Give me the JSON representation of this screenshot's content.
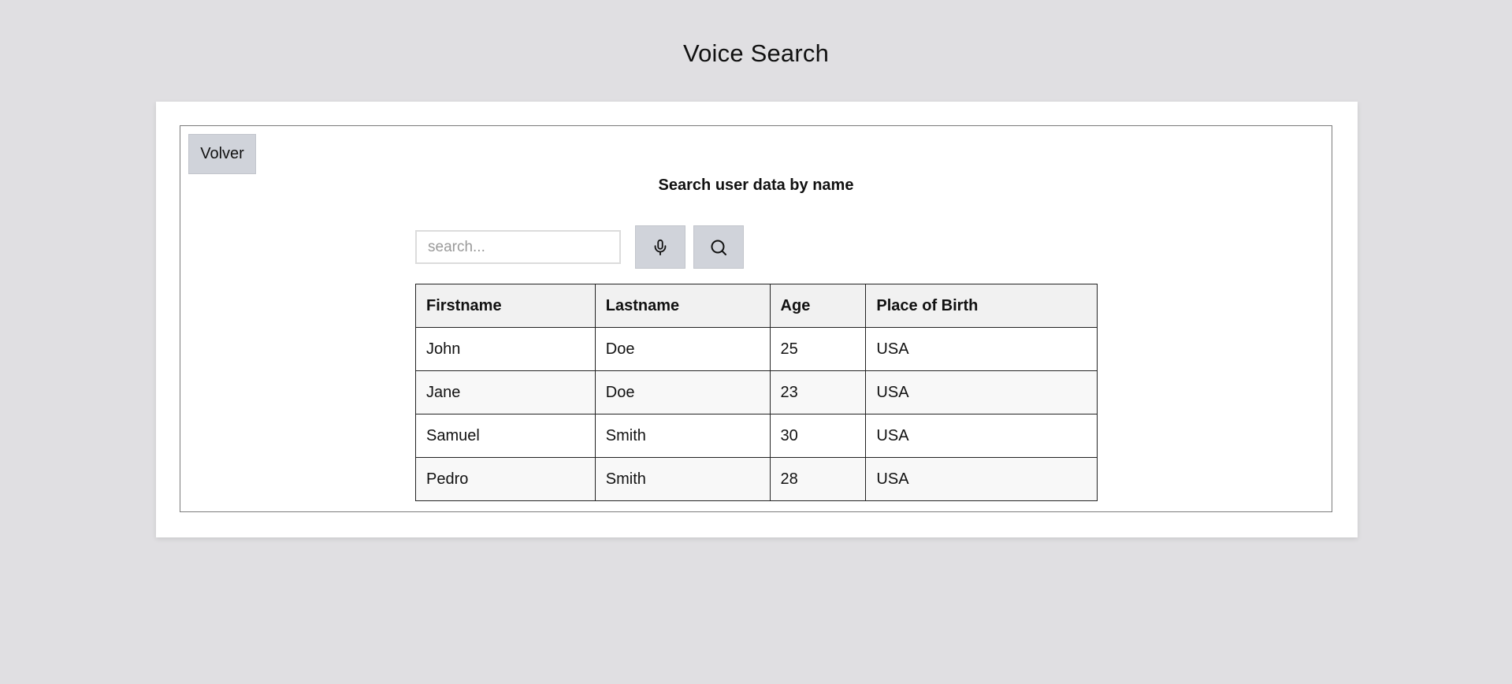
{
  "page": {
    "title": "Voice Search"
  },
  "panel": {
    "back_label": "Volver",
    "subtitle": "Search user data by name"
  },
  "search": {
    "placeholder": "search...",
    "value": "",
    "mic_icon": "microphone-icon",
    "search_icon": "search-icon"
  },
  "table": {
    "headers": [
      "Firstname",
      "Lastname",
      "Age",
      "Place of Birth"
    ],
    "rows": [
      [
        "John",
        "Doe",
        "25",
        "USA"
      ],
      [
        "Jane",
        "Doe",
        "23",
        "USA"
      ],
      [
        "Samuel",
        "Smith",
        "30",
        "USA"
      ],
      [
        "Pedro",
        "Smith",
        "28",
        "USA"
      ]
    ]
  },
  "colors": {
    "background": "#e0dfe2",
    "card": "#ffffff",
    "button": "#d0d3da",
    "header_row": "#f1f1f1",
    "alt_row": "#f8f8f8"
  }
}
